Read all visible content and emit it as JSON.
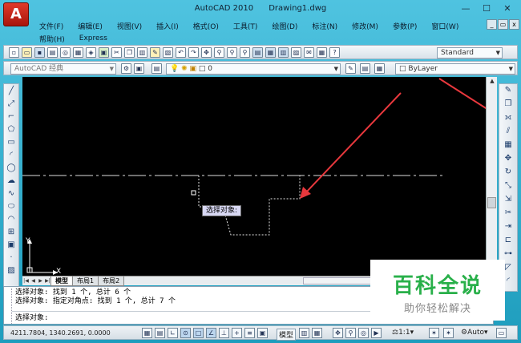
{
  "window": {
    "title": "AutoCAD 2010",
    "document": "Drawing1.dwg",
    "logo_letter": "A",
    "minimize": "—",
    "maximize": "☐",
    "close": "✕"
  },
  "menu": {
    "row1": [
      "文件(F)",
      "编辑(E)",
      "视图(V)",
      "插入(I)",
      "格式(O)",
      "工具(T)",
      "绘图(D)",
      "标注(N)",
      "修改(M)",
      "参数(P)",
      "窗口(W)"
    ],
    "row2": [
      "帮助(H)",
      "Express"
    ],
    "mdi_buttons": [
      "_",
      "▭",
      "x"
    ]
  },
  "toolbar": {
    "text_style": "Standard",
    "workspace": "AutoCAD 经典",
    "layer": "0",
    "color": "ByLayer"
  },
  "left_tools": [
    "line-icon",
    "xline-icon",
    "polyline-icon",
    "polygon-icon",
    "rectangle-icon",
    "arc-icon",
    "circle-icon",
    "revcloud-icon",
    "spline-icon",
    "ellipse-icon",
    "ellipse-arc-icon",
    "insert-block-icon",
    "make-block-icon",
    "point-icon",
    "hatch-icon"
  ],
  "right_tools": [
    "erase-icon",
    "copy-icon",
    "mirror-icon",
    "offset-icon",
    "array-icon",
    "move-icon",
    "rotate-icon",
    "scale-icon",
    "stretch-icon",
    "trim-icon",
    "extend-icon",
    "break-icon",
    "join-icon",
    "chamfer-icon",
    "fillet-icon"
  ],
  "canvas": {
    "tooltip": "选择对象:",
    "ucs_x": "X",
    "ucs_y": "Y",
    "colors": {
      "background": "#000000",
      "line": "#ffffff",
      "arrow": "#e8383d"
    }
  },
  "tabs": {
    "items": [
      "模型",
      "布局1",
      "布局2"
    ],
    "active": "模型"
  },
  "command": {
    "lines": [
      "选择对象: 找到 1 个, 总计 6 个",
      "选择对象: 指定对角点: 找到 1 个, 总计 7 个"
    ],
    "prompt": "选择对象:"
  },
  "status": {
    "coords": "4211.7804, 1340.2691, 0.0000",
    "model_label": "模型",
    "annotation_scale": "1:1",
    "auto_label": "Auto"
  },
  "watermark": {
    "title": "百科全说",
    "subtitle": "助你轻松解决"
  }
}
